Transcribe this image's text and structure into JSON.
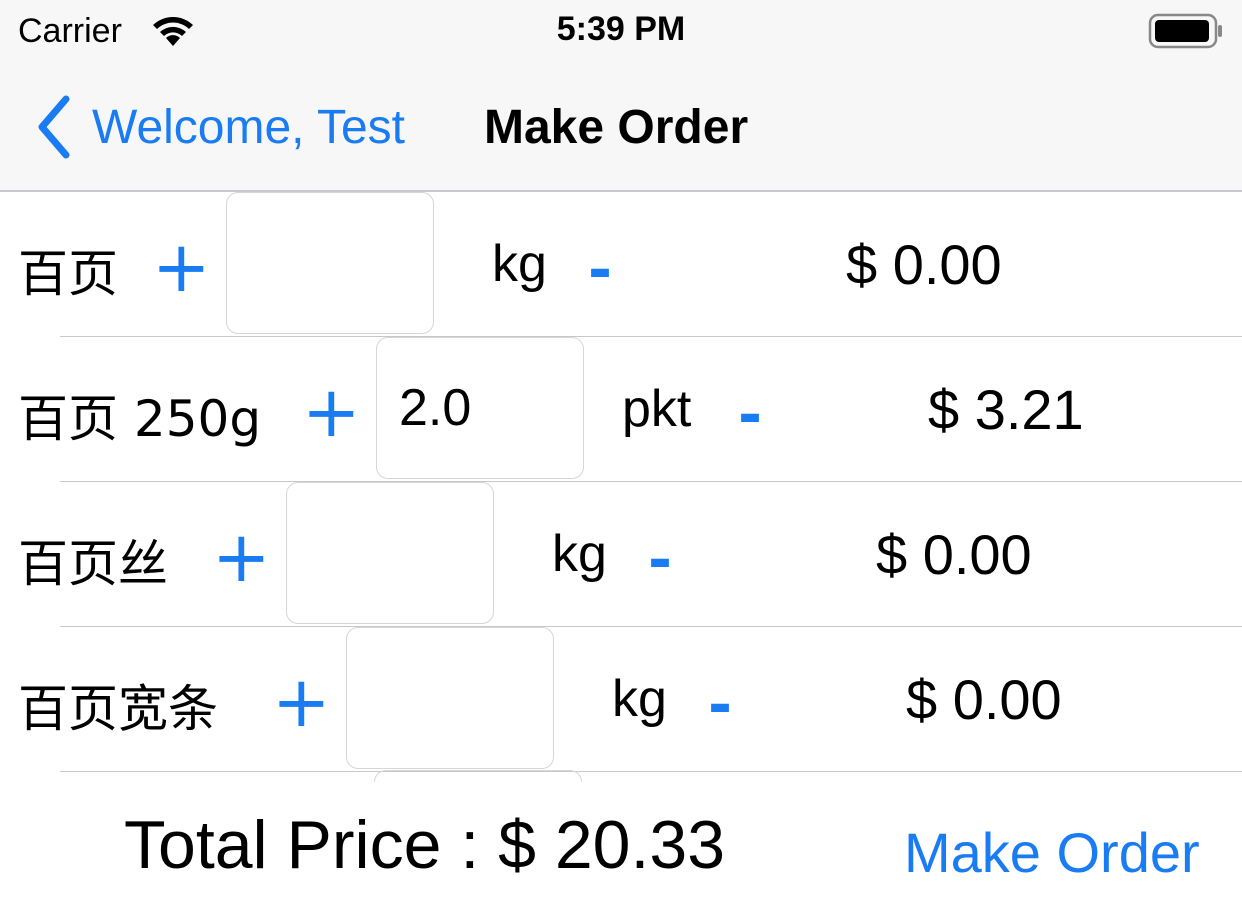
{
  "status_bar": {
    "carrier": "Carrier",
    "time": "5:39 PM",
    "wifi_icon": "wifi-icon",
    "battery_icon": "battery-icon"
  },
  "nav": {
    "back_label": "Welcome, Test",
    "back_icon": "chevron-left-icon",
    "title": "Make Order"
  },
  "items": [
    {
      "name": "百页",
      "plus": "+",
      "quantity": "",
      "unit": "kg",
      "minus": "-",
      "price": "$ 0.00"
    },
    {
      "name": "百页 250g",
      "plus": "+",
      "quantity": "2.0",
      "unit": "pkt",
      "minus": "-",
      "price": "$ 3.21"
    },
    {
      "name": "百页丝",
      "plus": "+",
      "quantity": "",
      "unit": "kg",
      "minus": "-",
      "price": "$ 0.00"
    },
    {
      "name": "百页宽条",
      "plus": "+",
      "quantity": "",
      "unit": "kg",
      "minus": "-",
      "price": "$ 0.00"
    }
  ],
  "footer": {
    "total_price": "Total Price : $ 20.33",
    "make_order_label": "Make Order"
  },
  "colors": {
    "accent": "#1a7cf2",
    "bar_background": "#f7f7f7",
    "separator": "#c8c7cc"
  }
}
